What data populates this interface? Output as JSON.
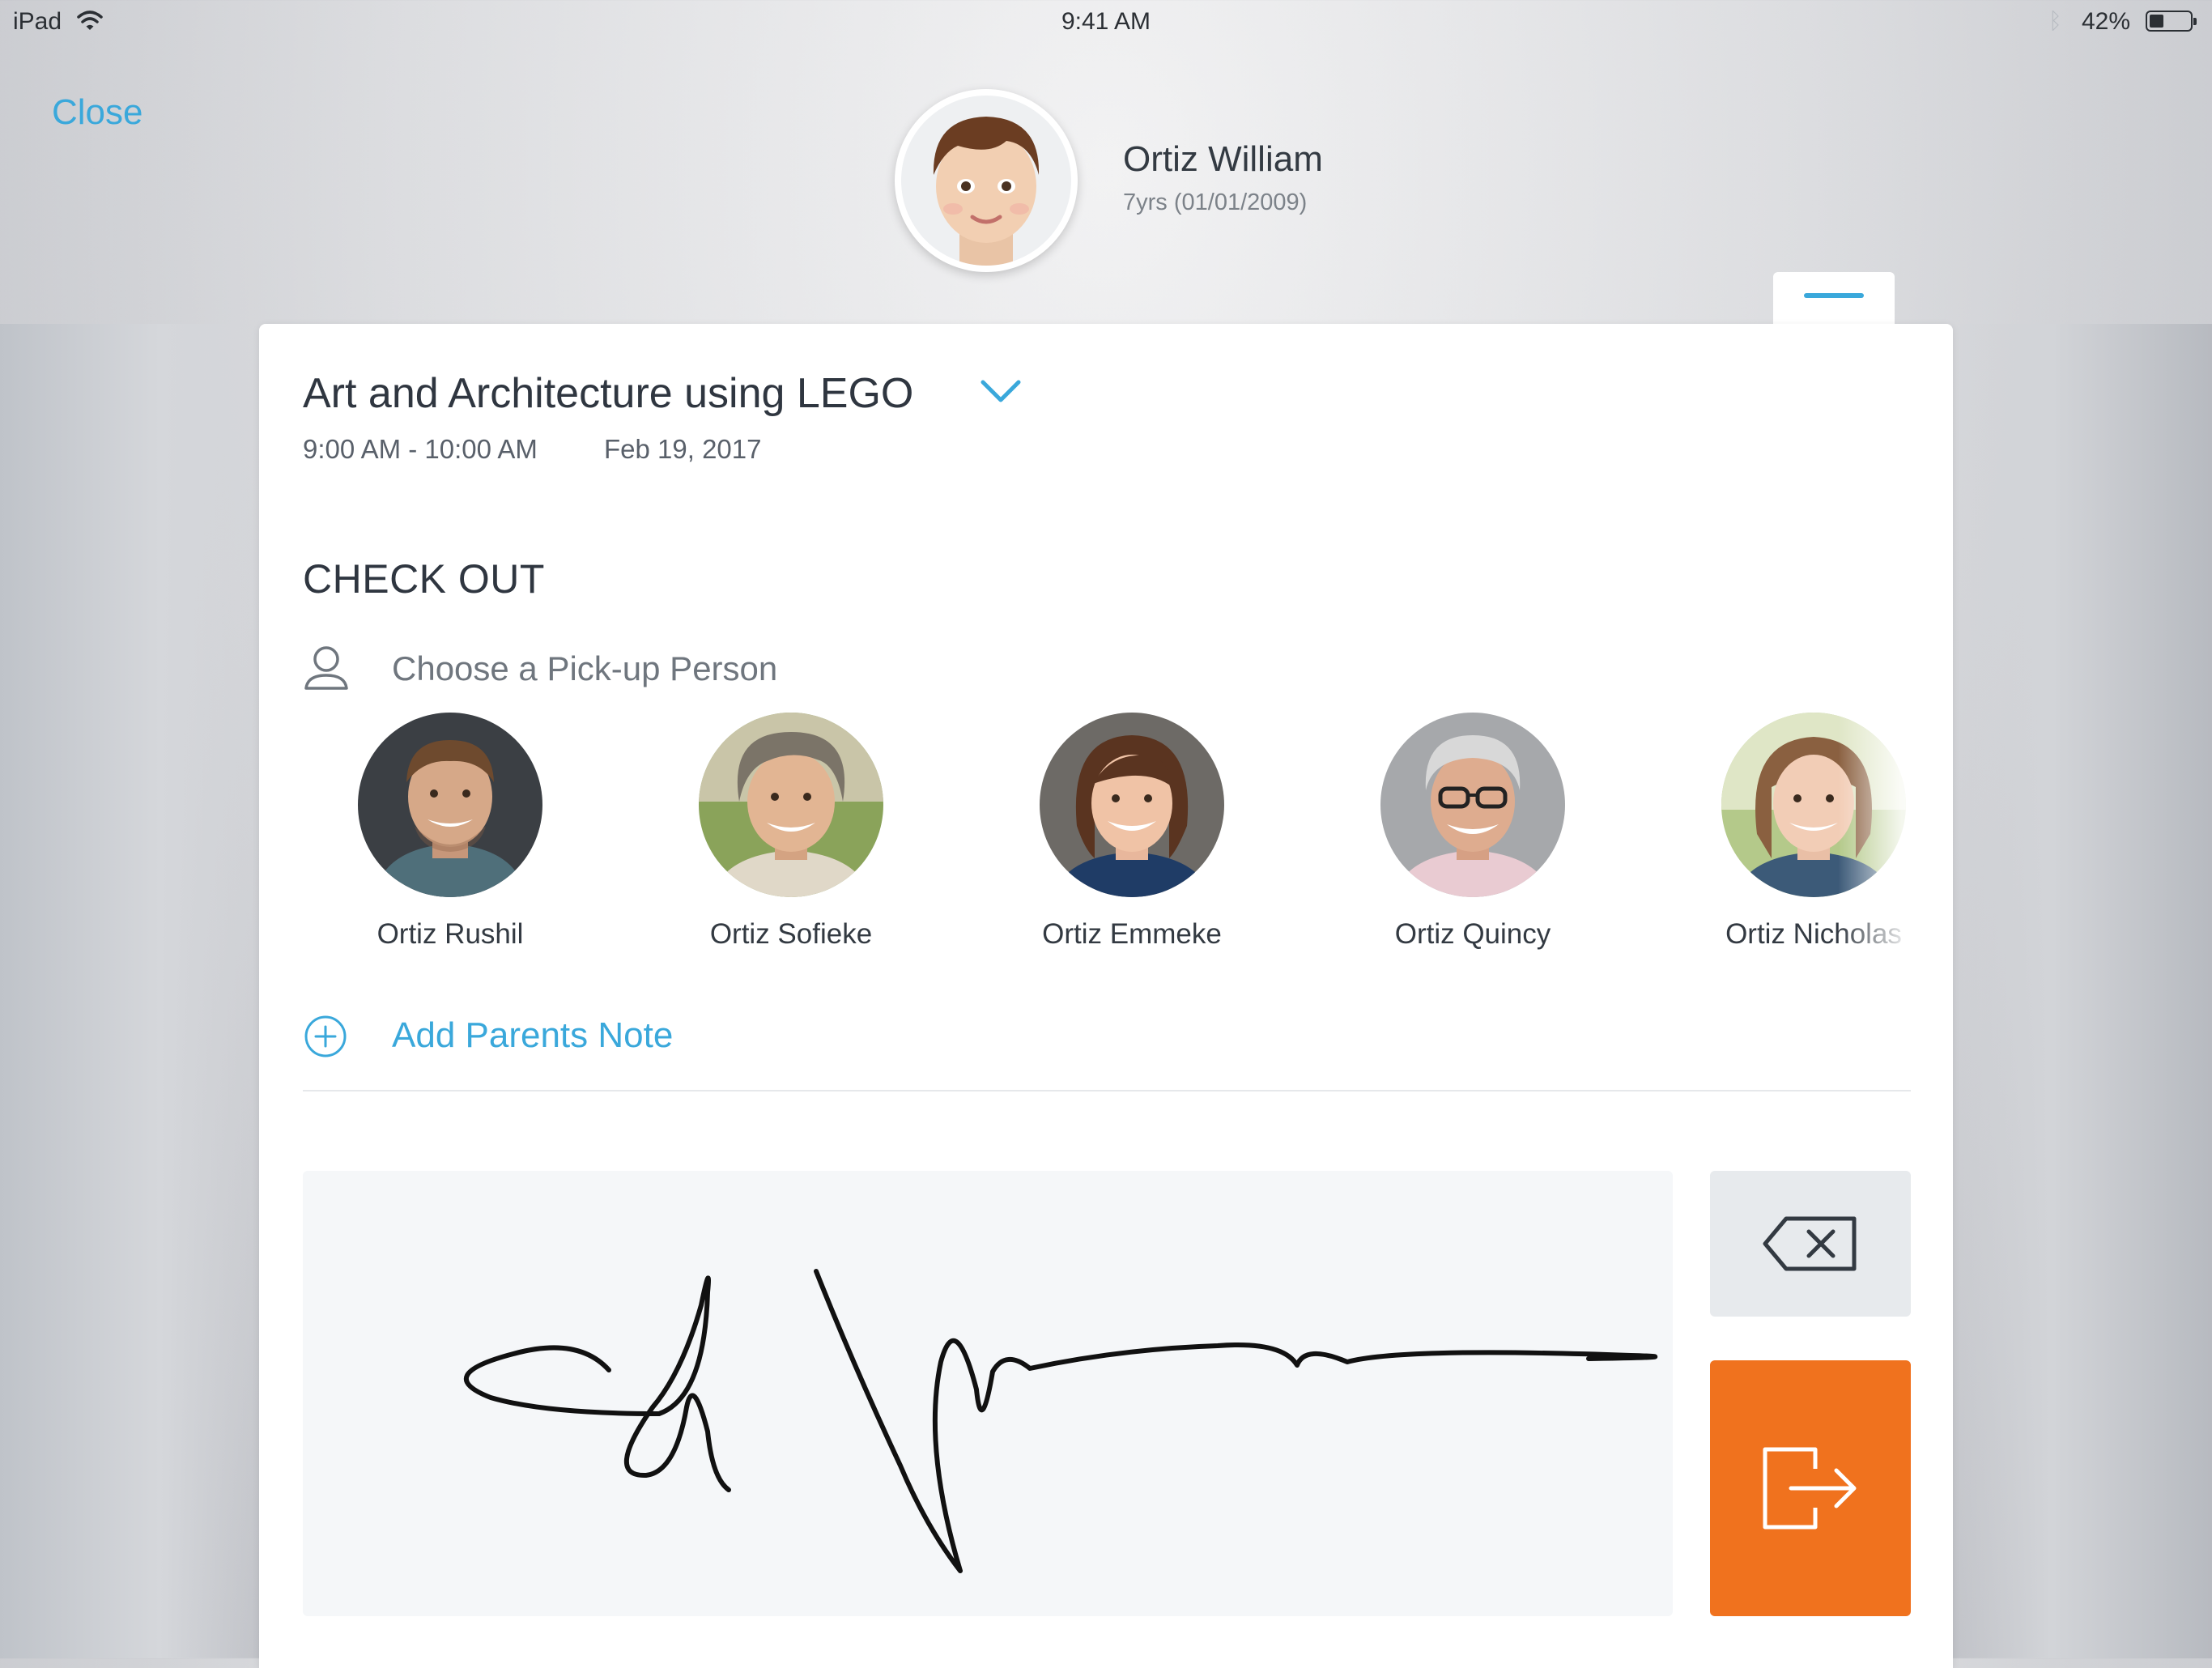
{
  "status_bar": {
    "device": "iPad",
    "time": "9:41 AM",
    "battery_pct": "42%",
    "battery_level": 0.42
  },
  "nav": {
    "close_label": "Close"
  },
  "child": {
    "name": "Ortiz William",
    "age": "7yrs (01/01/2009)"
  },
  "program": {
    "title": "Art and Architecture using LEGO",
    "time": "9:00 AM - 10:00 AM",
    "date": "Feb 19, 2017"
  },
  "checkout": {
    "section_title": "CHECK OUT",
    "pickup_label": "Choose a Pick-up Person",
    "people": [
      {
        "name": "Ortiz Rushil"
      },
      {
        "name": "Ortiz Sofieke"
      },
      {
        "name": "Ortiz Emmeke"
      },
      {
        "name": "Ortiz Quincy"
      },
      {
        "name": "Ortiz Nicholas"
      }
    ],
    "add_note_label": "Add Parents Note"
  },
  "colors": {
    "accent": "#3aa8db",
    "checkout": "#f0721e",
    "pad": "#f5f7f9",
    "clear": "#e7eaed"
  }
}
